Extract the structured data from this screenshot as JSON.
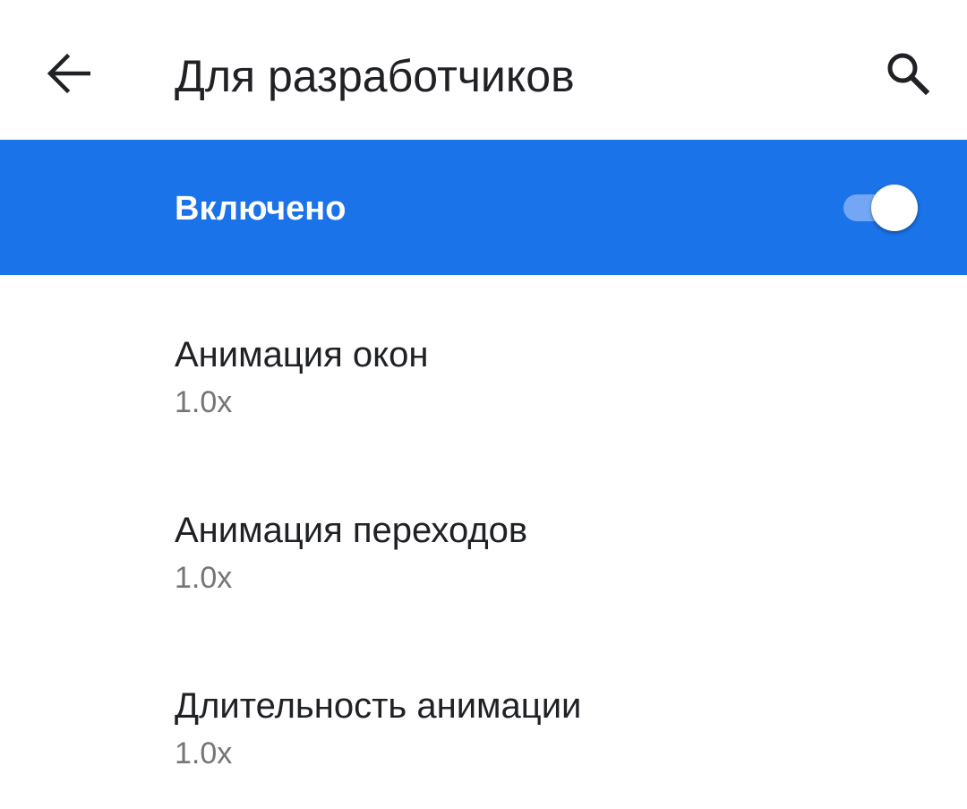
{
  "header": {
    "back_icon": "arrow-back-icon",
    "title": "Для разработчиков",
    "search_icon": "search-icon"
  },
  "master_switch": {
    "label": "Включено",
    "checked": true,
    "background_color": "#1a73e8"
  },
  "settings": [
    {
      "title": "Анимация окон",
      "value": "1.0x"
    },
    {
      "title": "Анимация переходов",
      "value": "1.0x"
    },
    {
      "title": "Длительность анимации",
      "value": "1.0x"
    }
  ]
}
